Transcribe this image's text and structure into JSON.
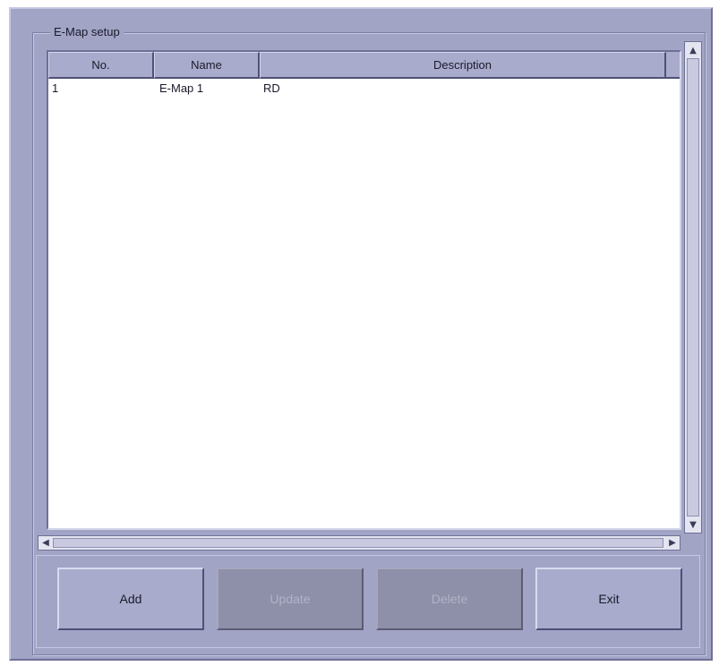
{
  "dialog": {
    "group_title": "E-Map setup"
  },
  "table": {
    "columns": [
      "No.",
      "Name",
      "Description"
    ],
    "rows": [
      {
        "no": "1",
        "name": "E-Map 1",
        "description": "RD"
      }
    ]
  },
  "buttons": {
    "add": "Add",
    "update": "Update",
    "delete": "Delete",
    "exit": "Exit"
  },
  "icons": {
    "scroll_up": "triangle-up-icon",
    "scroll_down": "triangle-down-icon",
    "scroll_left": "triangle-left-icon",
    "scroll_right": "triangle-right-icon"
  },
  "colors": {
    "panel": "#a2a4c6",
    "button": "#a9abcc",
    "button_disabled": "#8e8fa8"
  }
}
